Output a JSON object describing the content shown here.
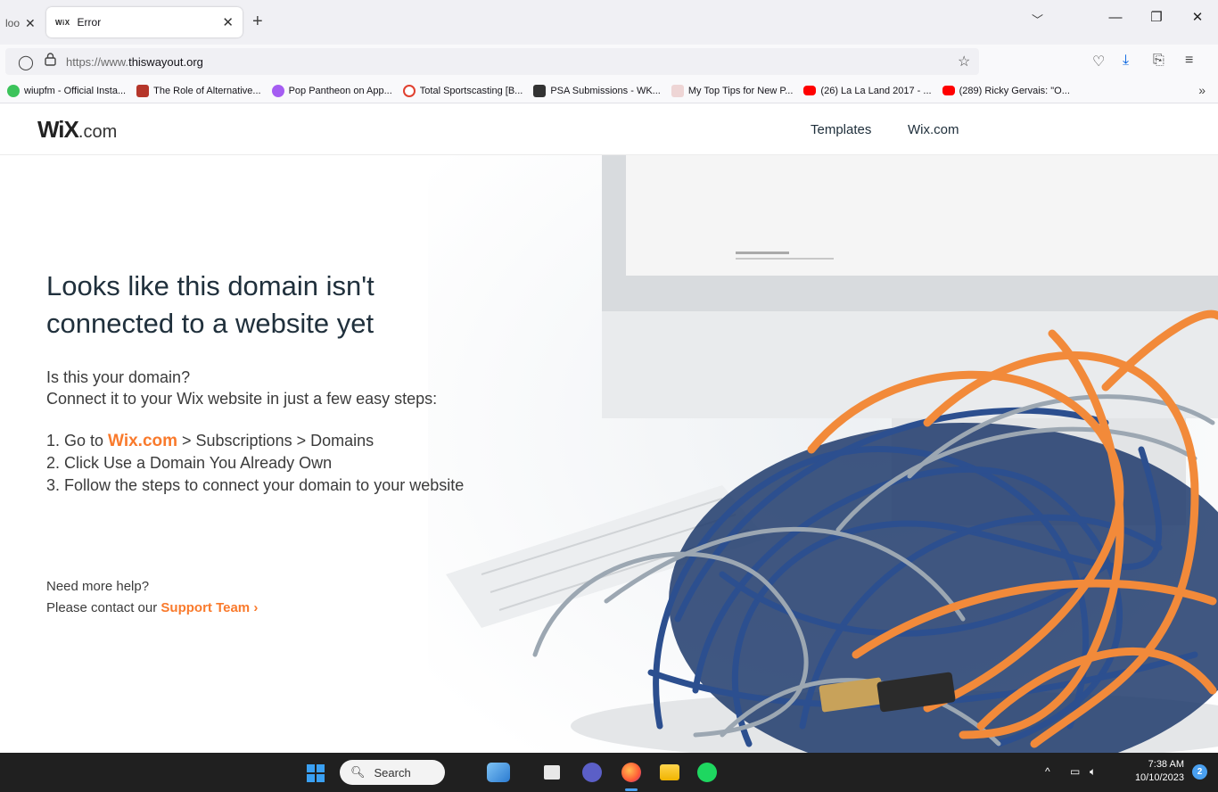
{
  "browser": {
    "prev_tab_label": "loo",
    "active_tab": {
      "favicon": "WiX",
      "title": "Error"
    },
    "url": {
      "prefix": "https://www.",
      "domain": "thiswayout.org"
    },
    "bookmarks": [
      {
        "label": "wiupfm - Official Insta...",
        "color": "#3cc35b"
      },
      {
        "label": "The Role of Alternative...",
        "color": "#b5362a"
      },
      {
        "label": "Pop Pantheon on App...",
        "color": "#a55df2"
      },
      {
        "label": "Total Sportscasting [B...",
        "color": "#e0402f"
      },
      {
        "label": "PSA Submissions - WK...",
        "color": "#333333"
      },
      {
        "label": "My Top Tips for New P...",
        "color": "#d9a3a3"
      },
      {
        "label": "(26) La La Land 2017 - ...",
        "color": "#ff0000"
      },
      {
        "label": "(289) Ricky Gervais: \"O...",
        "color": "#ff0000"
      }
    ]
  },
  "header": {
    "logo_main": "WiX",
    "logo_suffix": ".com",
    "nav": [
      "Templates",
      "Wix.com"
    ]
  },
  "main": {
    "headline_line1": "Looks like this domain isn't",
    "headline_line2": "connected to a website yet",
    "question": "Is this your domain?",
    "instruction": "Connect it to your Wix website in just a few easy steps:",
    "step1_prefix": "1. Go to ",
    "step1_link": "Wix.com",
    "step1_suffix": " > Subscriptions > Domains",
    "step2": "2. Click Use a Domain You Already Own",
    "step3": "3. Follow the steps to connect your domain to your website",
    "help_line1": "Need more help?",
    "help_prefix": "Please contact our ",
    "help_link": "Support Team ›"
  },
  "taskbar": {
    "search_label": "Search",
    "time": "7:38 AM",
    "date": "10/10/2023",
    "notification_count": "2"
  },
  "colors": {
    "accent": "#f97a2c",
    "text": "#20303c"
  }
}
